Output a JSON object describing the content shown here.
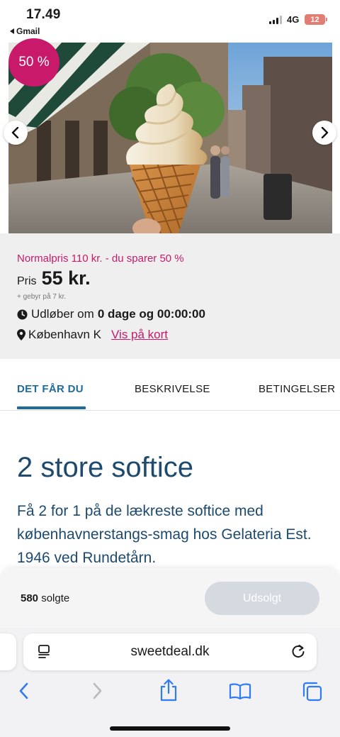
{
  "status_bar": {
    "time": "17.49",
    "back_app": "Gmail",
    "network": "4G",
    "battery": "12"
  },
  "hero": {
    "discount_badge": "50 %",
    "prev_icon": "chevron-left-icon",
    "next_icon": "chevron-right-icon"
  },
  "deal": {
    "normal_price": "Normalpris 110 kr. - du sparer 50 %",
    "price_label": "Pris",
    "price_value": "55 kr.",
    "fee": "+ gebyr på 7 kr.",
    "expires_label": "Udløber om",
    "expires_value": "0 dage og 00:00:00",
    "location": "København K",
    "map_link": "Vis på kort"
  },
  "tabs": [
    {
      "label": "DET FÅR DU",
      "active": true
    },
    {
      "label": "BESKRIVELSE",
      "active": false
    },
    {
      "label": "BETINGELSER",
      "active": false
    }
  ],
  "content": {
    "title": "2 store softice",
    "description": "Få 2 for 1 på de lækreste softice med københavnerstangs-smag hos Gelateria Est. 1946 ved Rundetårn."
  },
  "purchase_bar": {
    "sold_count": "580",
    "sold_label": "solgte",
    "button_label": "Udsolgt"
  },
  "browser": {
    "url": "sweetdeal.dk"
  },
  "colors": {
    "accent": "#c8196b",
    "heading": "#1d4a6e",
    "tab_active": "#1f6b99",
    "ios_blue": "#2f7bf6"
  }
}
